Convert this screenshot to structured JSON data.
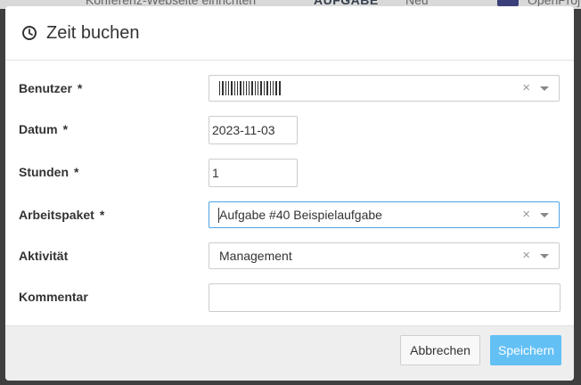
{
  "background": {
    "row_text": "Konferenz-Webseite einrichten",
    "type_badge": "AUFGABE",
    "status": "Neu",
    "project": "OpenProj"
  },
  "dialog": {
    "title": "Zeit buchen",
    "title_icon": "clock-icon"
  },
  "form": {
    "required_mark": "*",
    "user": {
      "label": "Benutzer",
      "required": true,
      "value_redacted": true,
      "clear_glyph": "×"
    },
    "date": {
      "label": "Datum",
      "required": true,
      "value": "2023-11-03"
    },
    "hours": {
      "label": "Stunden",
      "required": true,
      "value": "1"
    },
    "work_package": {
      "label": "Arbeitspaket",
      "required": true,
      "value": "Aufgabe #40 Beispielaufgabe",
      "clear_glyph": "×"
    },
    "activity": {
      "label": "Aktivität",
      "required": false,
      "value": "Management",
      "clear_glyph": "×"
    },
    "comment": {
      "label": "Kommentar",
      "required": false,
      "value": ""
    }
  },
  "footer": {
    "cancel_label": "Abbrechen",
    "save_label": "Speichern"
  },
  "colors": {
    "primary": "#63c0f5",
    "focus_border": "#4da3e6",
    "overlay": "#3f3f3f"
  }
}
